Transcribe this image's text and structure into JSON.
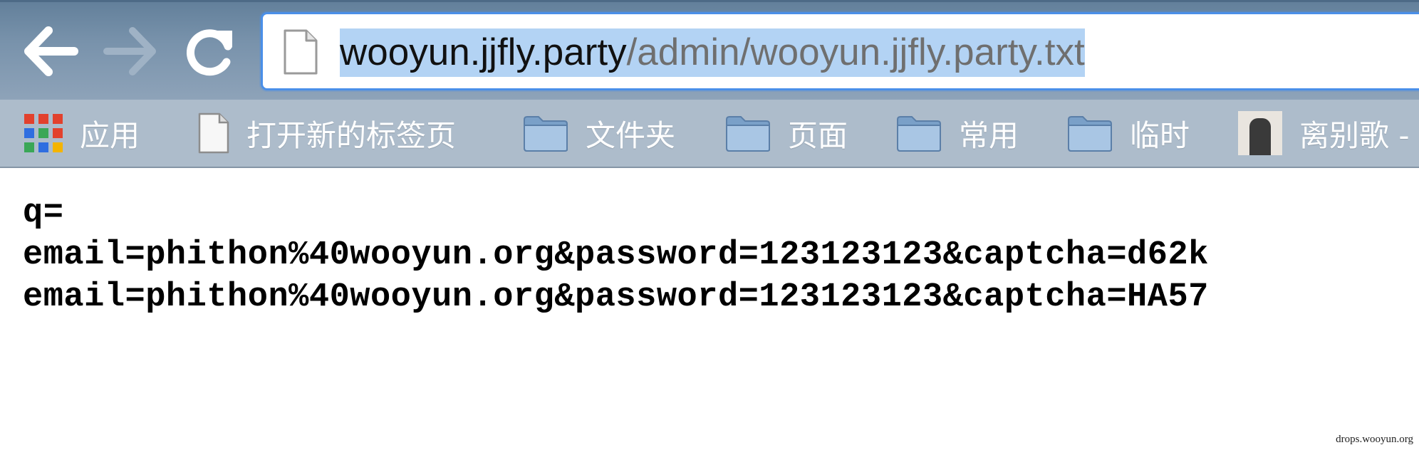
{
  "browser": {
    "nav": {
      "back_icon": "arrow-left-icon",
      "forward_icon": "arrow-right-icon",
      "reload_icon": "reload-icon"
    },
    "address_bar": {
      "host": "wooyun.jjfly.party",
      "path": "/admin/wooyun.jjfly.party.txt",
      "icon": "page-icon",
      "selected": true,
      "selection_color": "#b3d3f4",
      "focus_color": "#4a8fe8"
    },
    "bookmarks": [
      {
        "label": "应用",
        "icon": "apps-grid-icon"
      },
      {
        "label": "打开新的标签页",
        "icon": "document-icon"
      },
      {
        "label": "文件夹",
        "icon": "folder-icon"
      },
      {
        "label": "页面",
        "icon": "folder-icon"
      },
      {
        "label": "常用",
        "icon": "folder-icon"
      },
      {
        "label": "临时",
        "icon": "folder-icon"
      },
      {
        "label": "离别歌 -",
        "icon": "avatar-thumbnail"
      }
    ]
  },
  "document": {
    "lines": [
      "q=",
      "email=phithon%40wooyun.org&password=123123123&captcha=d62k",
      "email=phithon%40wooyun.org&password=123123123&captcha=HA57"
    ]
  },
  "watermark": "drops.wooyun.org"
}
